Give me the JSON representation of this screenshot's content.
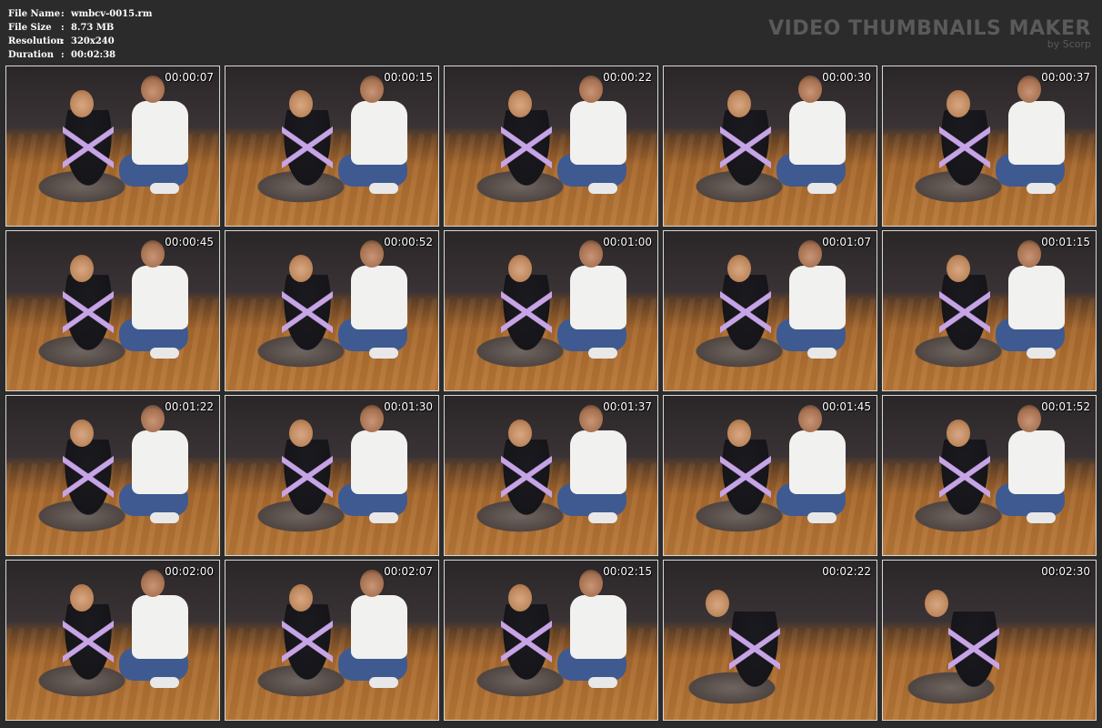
{
  "info": {
    "rows": [
      {
        "label": "File Name",
        "sep": ":",
        "value": "wmbcv-0015.rm"
      },
      {
        "label": "File Size",
        "sep": ":",
        "value": "8.73 MB"
      },
      {
        "label": "Resolution",
        "sep": ":",
        "value": "320x240"
      },
      {
        "label": "Duration",
        "sep": ":",
        "value": "00:02:38"
      }
    ]
  },
  "brand": {
    "title": "VIDEO THUMBNAILS MAKER",
    "subtitle": "by Scorp"
  },
  "thumbnails": [
    {
      "time": "00:00:07"
    },
    {
      "time": "00:00:15"
    },
    {
      "time": "00:00:22"
    },
    {
      "time": "00:00:30"
    },
    {
      "time": "00:00:37"
    },
    {
      "time": "00:00:45"
    },
    {
      "time": "00:00:52"
    },
    {
      "time": "00:01:00"
    },
    {
      "time": "00:01:07"
    },
    {
      "time": "00:01:15"
    },
    {
      "time": "00:01:22"
    },
    {
      "time": "00:01:30"
    },
    {
      "time": "00:01:37"
    },
    {
      "time": "00:01:45"
    },
    {
      "time": "00:01:52"
    },
    {
      "time": "00:02:00"
    },
    {
      "time": "00:02:07"
    },
    {
      "time": "00:02:15"
    },
    {
      "time": "00:02:22"
    },
    {
      "time": "00:02:30"
    }
  ],
  "colors": {
    "background": "#2b2b2b",
    "thumbnail_border": "#d8d8d8",
    "brand_text": "#5a5a5a"
  }
}
